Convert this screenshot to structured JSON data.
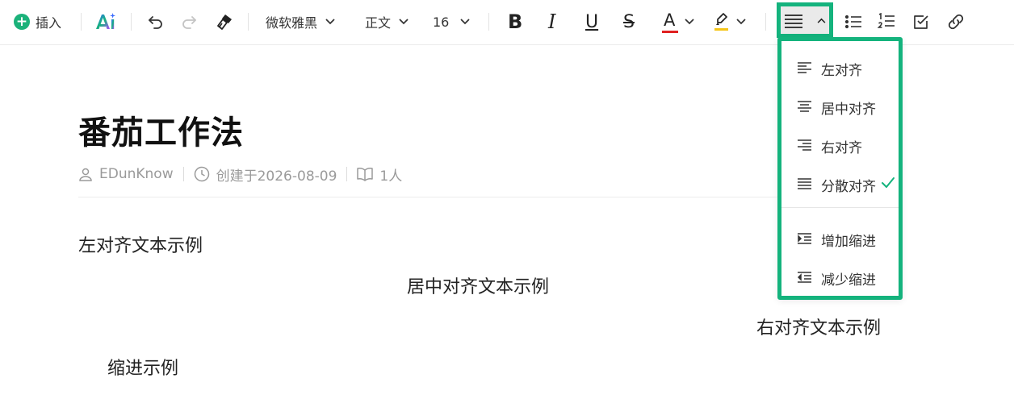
{
  "toolbar": {
    "insert_label": "插入",
    "ai_label": "AI",
    "font_family": "微软雅黑",
    "paragraph_style": "正文",
    "font_size": "16",
    "bold_glyph": "B",
    "italic_glyph": "I",
    "underline_glyph": "U",
    "strike_glyph": "S",
    "text_color_glyph": "A",
    "accent_color": "#14b37d",
    "text_color_swatch": "#e02020",
    "highlight_swatch": "#f5c518"
  },
  "align_menu": {
    "items": [
      {
        "label": "左对齐",
        "icon": "align-left-icon"
      },
      {
        "label": "居中对齐",
        "icon": "align-center-icon"
      },
      {
        "label": "右对齐",
        "icon": "align-right-icon"
      },
      {
        "label": "分散对齐",
        "icon": "align-justify-icon",
        "checked": true
      },
      {
        "label": "增加缩进",
        "icon": "indent-increase-icon"
      },
      {
        "label": "减少缩进",
        "icon": "indent-decrease-icon"
      }
    ]
  },
  "document": {
    "title": "番茄工作法",
    "author": "EDunKnow",
    "created": "创建于2026-08-09",
    "readers": "1人",
    "paragraphs": {
      "left": "左对齐文本示例",
      "center": "居中对齐文本示例",
      "right": "右对齐文本示例",
      "indent": "缩进示例"
    }
  }
}
